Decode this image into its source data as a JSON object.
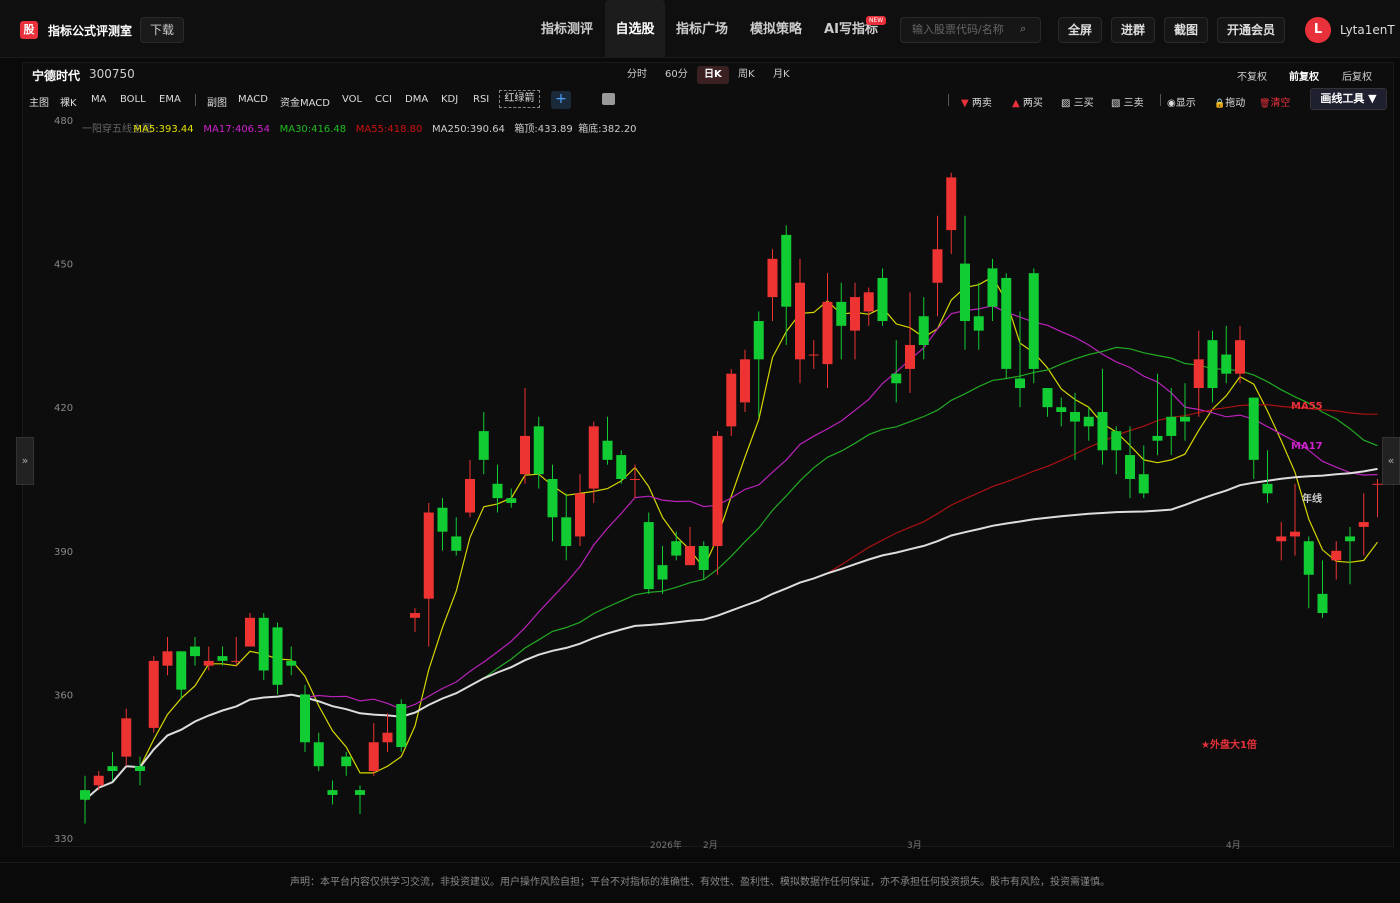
{
  "header": {
    "logo_char": "股",
    "title": "指标公式评测室",
    "download": "下载",
    "nav": [
      {
        "label": "指标测评",
        "active": false
      },
      {
        "label": "自选股",
        "active": true
      },
      {
        "label": "指标广场",
        "active": false
      },
      {
        "label": "模拟策略",
        "active": false
      },
      {
        "label": "AI写指标",
        "active": false
      }
    ],
    "new_badge": "NEW",
    "search_placeholder": "输入股票代码/名称",
    "buttons": [
      "全屏",
      "进群",
      "截图",
      "开通会员"
    ],
    "avatar_letter": "L",
    "username": "Lyta1enT"
  },
  "stock": {
    "name": "宁德时代",
    "code": "300750"
  },
  "periods": [
    {
      "label": "分时",
      "active": false
    },
    {
      "label": "60分",
      "active": false
    },
    {
      "label": "日K",
      "active": true
    },
    {
      "label": "周K",
      "active": false
    },
    {
      "label": "月K",
      "active": false
    }
  ],
  "fuquan": [
    {
      "label": "不复权",
      "active": false
    },
    {
      "label": "前复权",
      "active": true
    },
    {
      "label": "后复权",
      "active": false
    }
  ],
  "indicators": [
    "主图",
    "裸K",
    "MA",
    "BOLL",
    "EMA",
    "副图",
    "MACD",
    "资金MACD",
    "VOL",
    "CCI",
    "DMA",
    "KDJ",
    "RSI"
  ],
  "indicator_box": "红绿箭",
  "plus": "+",
  "draw_tools": [
    {
      "label": "两卖",
      "icon": "▼",
      "color": "#e8313a"
    },
    {
      "label": "两买",
      "icon": "▲",
      "color": "#e8313a"
    },
    {
      "label": "三买",
      "icon": "▨",
      "color": "#ddd"
    },
    {
      "label": "三卖",
      "icon": "▧",
      "color": "#ddd"
    },
    {
      "label": "显示",
      "icon": "◉",
      "color": "#ddd"
    },
    {
      "label": "拖动",
      "icon": "🔒",
      "color": "#ddd"
    },
    {
      "label": "清空",
      "icon": "🗑",
      "color": "#e8313a"
    }
  ],
  "draw_button": "画线工具 ▼",
  "side_left": "»",
  "side_right": "«",
  "legend": [
    {
      "label": "一阳穿五线主图",
      "color": "#666"
    },
    {
      "label": "MA5:393.44",
      "color": "#e0e000"
    },
    {
      "label": "MA17:406.54",
      "color": "#cc22cc"
    },
    {
      "label": "MA30:416.48",
      "color": "#22bb22"
    },
    {
      "label": "MA55:418.80",
      "color": "#cc1111"
    },
    {
      "label": "MA250:390.64",
      "color": "#cccccc"
    },
    {
      "label": "箱顶:433.89",
      "color": "#cccccc"
    },
    {
      "label": "箱底:382.20",
      "color": "#cccccc"
    }
  ],
  "chart_data": {
    "type": "candlestick",
    "ylim": [
      330,
      480
    ],
    "yticks": [
      330,
      360,
      390,
      420,
      450,
      480
    ],
    "xticks": [
      "2026年",
      "2月",
      "3月",
      "4月"
    ],
    "labels": {
      "ma55": "MA55",
      "ma17": "MA17",
      "ma250": "年线",
      "note": "★外盘大1倍"
    },
    "candles": [
      [
        340,
        338,
        343,
        333
      ],
      [
        341,
        343,
        344,
        340
      ],
      [
        345,
        344,
        348,
        342
      ],
      [
        347,
        355,
        357,
        345
      ],
      [
        345,
        344,
        347,
        341
      ],
      [
        353,
        367,
        368,
        352
      ],
      [
        366,
        369,
        372,
        364
      ],
      [
        369,
        361,
        369,
        359
      ],
      [
        370,
        368,
        372,
        366
      ],
      [
        366,
        367,
        370,
        365
      ],
      [
        368,
        367,
        370,
        366
      ],
      [
        367,
        367,
        372,
        366
      ],
      [
        370,
        376,
        377,
        370
      ],
      [
        376,
        365,
        377,
        363
      ],
      [
        374,
        362,
        375,
        360
      ],
      [
        367,
        366,
        370,
        364
      ],
      [
        360,
        350,
        362,
        348
      ],
      [
        350,
        345,
        352,
        344
      ],
      [
        340,
        339,
        342,
        337
      ],
      [
        347,
        345,
        348,
        343
      ],
      [
        340,
        339,
        341,
        335
      ],
      [
        344,
        350,
        354,
        343
      ],
      [
        350,
        352,
        356,
        348
      ],
      [
        358,
        349,
        359,
        348
      ],
      [
        376,
        377,
        378,
        373
      ],
      [
        380,
        398,
        400,
        370
      ],
      [
        399,
        394,
        401,
        390
      ],
      [
        393,
        390,
        397,
        389
      ],
      [
        398,
        405,
        409,
        397
      ],
      [
        415,
        409,
        419,
        406
      ],
      [
        404,
        401,
        408,
        398
      ],
      [
        401,
        400,
        403,
        399
      ],
      [
        406,
        414,
        424,
        404
      ],
      [
        416,
        406,
        418,
        403
      ],
      [
        405,
        397,
        408,
        392
      ],
      [
        397,
        391,
        402,
        388
      ],
      [
        393,
        402,
        406,
        391
      ],
      [
        403,
        416,
        417,
        400
      ],
      [
        413,
        409,
        418,
        408
      ],
      [
        410,
        405,
        411,
        404
      ],
      [
        405,
        405,
        408,
        401
      ],
      [
        396,
        382,
        398,
        381
      ],
      [
        387,
        384,
        391,
        381
      ],
      [
        392,
        389,
        394,
        388
      ],
      [
        387,
        391,
        395,
        387
      ],
      [
        391,
        386,
        392,
        384
      ],
      [
        391,
        414,
        415,
        385
      ],
      [
        416,
        427,
        428,
        414
      ],
      [
        421,
        430,
        432,
        419
      ],
      [
        438,
        430,
        440,
        418
      ],
      [
        443,
        451,
        453,
        438
      ],
      [
        456,
        441,
        458,
        433
      ],
      [
        430,
        446,
        451,
        425
      ],
      [
        431,
        431,
        434,
        428
      ],
      [
        429,
        442,
        448,
        424
      ],
      [
        442,
        437,
        446,
        430
      ],
      [
        436,
        443,
        446,
        430
      ],
      [
        440,
        444,
        445,
        437
      ],
      [
        447,
        438,
        449,
        437
      ],
      [
        427,
        425,
        434,
        421
      ],
      [
        428,
        433,
        444,
        423
      ],
      [
        439,
        433,
        443,
        430
      ],
      [
        446,
        453,
        460,
        439
      ],
      [
        457,
        468,
        469,
        452
      ],
      [
        450,
        438,
        460,
        432
      ],
      [
        439,
        436,
        446,
        432
      ],
      [
        449,
        441,
        451,
        438
      ],
      [
        447,
        428,
        448,
        426
      ],
      [
        426,
        424,
        440,
        420
      ],
      [
        448,
        428,
        449,
        425
      ],
      [
        424,
        420,
        424,
        418
      ],
      [
        420,
        419,
        422,
        416
      ],
      [
        419,
        417,
        423,
        409
      ],
      [
        418,
        416,
        420,
        413
      ],
      [
        419,
        411,
        428,
        408
      ],
      [
        415,
        411,
        416,
        406
      ],
      [
        410,
        405,
        416,
        401
      ],
      [
        406,
        402,
        412,
        401
      ],
      [
        414,
        413,
        427,
        410
      ],
      [
        418,
        414,
        424,
        410
      ],
      [
        418,
        417,
        425,
        413
      ],
      [
        424,
        430,
        436,
        418
      ],
      [
        434,
        424,
        436,
        421
      ],
      [
        431,
        427,
        437,
        425
      ],
      [
        427,
        434,
        437,
        425
      ],
      [
        422,
        409,
        422,
        405
      ],
      [
        404,
        402,
        411,
        400
      ],
      [
        392,
        393,
        396,
        388
      ],
      [
        393,
        394,
        404,
        389
      ],
      [
        392,
        385,
        393,
        378
      ],
      [
        381,
        377,
        388,
        376
      ],
      [
        388,
        390,
        392,
        384
      ],
      [
        393,
        392,
        395,
        383
      ],
      [
        395,
        396,
        402,
        389
      ],
      [
        404,
        404,
        405,
        397
      ]
    ]
  },
  "footer": "声明：本平台内容仅供学习交流，非投资建议。用户操作风险自担；平台不对指标的准确性、有效性、盈利性、模拟数据作任何保证，亦不承担任何投资损失。股市有风险，投资需谨慎。"
}
